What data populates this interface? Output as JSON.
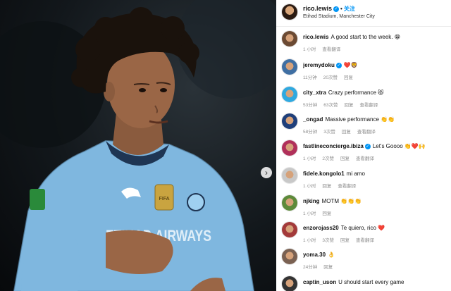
{
  "post": {
    "username": "rico.lewis",
    "follow_label": "关注",
    "location": "Etihad Stadium, Manchester City"
  },
  "nav": {
    "next_glyph": "›"
  },
  "jersey": {
    "sponsor_text": "ETIHAD AIRWAYS"
  },
  "comments": [
    {
      "user": "rico.lewis",
      "verified": false,
      "text": "A good start to the week. 😁",
      "time": "1 小时",
      "likes": "",
      "reply": "",
      "translate": "查看翻译",
      "avatar_color": "#6b4a33"
    },
    {
      "user": "jeremydoku",
      "verified": true,
      "text": "❤️🦁",
      "time": "11分钟",
      "likes": "20次赞",
      "reply": "回复",
      "translate": "",
      "avatar_color": "#3f6fa3"
    },
    {
      "user": "city_xtra",
      "verified": false,
      "text": "Crazy performance 😻",
      "time": "53分钟",
      "likes": "63次赞",
      "reply": "回复",
      "translate": "查看翻译",
      "avatar_color": "#2fa9e0"
    },
    {
      "user": "_ongad",
      "verified": false,
      "text": "Massive performance 👏👏",
      "time": "58分钟",
      "likes": "3次赞",
      "reply": "回复",
      "translate": "查看翻译",
      "avatar_color": "#1f3f7a"
    },
    {
      "user": "fastlineconcierge.ibiza",
      "verified": true,
      "text": "Let's Goooo 👏❤️🙌",
      "time": "1 小时",
      "likes": "2次赞",
      "reply": "回复",
      "translate": "查看翻译",
      "avatar_color": "#b0305a"
    },
    {
      "user": "fidele.kongolo1",
      "verified": false,
      "text": "mi amo",
      "time": "1 小时",
      "likes": "",
      "reply": "回复",
      "translate": "查看翻译",
      "avatar_color": "#c8c8c8"
    },
    {
      "user": "njking",
      "verified": false,
      "text": "MOTM 👏👏👏",
      "time": "1 小时",
      "likes": "",
      "reply": "回复",
      "translate": "",
      "avatar_color": "#5d8a3a"
    },
    {
      "user": "enzorojass20",
      "verified": false,
      "text": "Te quiero, rico ❤️",
      "time": "1 小时",
      "likes": "3次赞",
      "reply": "回复",
      "translate": "查看翻译",
      "avatar_color": "#a33a3a"
    },
    {
      "user": "yoma.30",
      "verified": false,
      "text": "👌",
      "time": "24分钟",
      "likes": "",
      "reply": "回复",
      "translate": "",
      "avatar_color": "#7a6152"
    },
    {
      "user": "captin_uson",
      "verified": false,
      "text": "U should start every game",
      "time": "",
      "likes": "",
      "reply": "",
      "translate": "",
      "avatar_color": "#333333"
    }
  ]
}
